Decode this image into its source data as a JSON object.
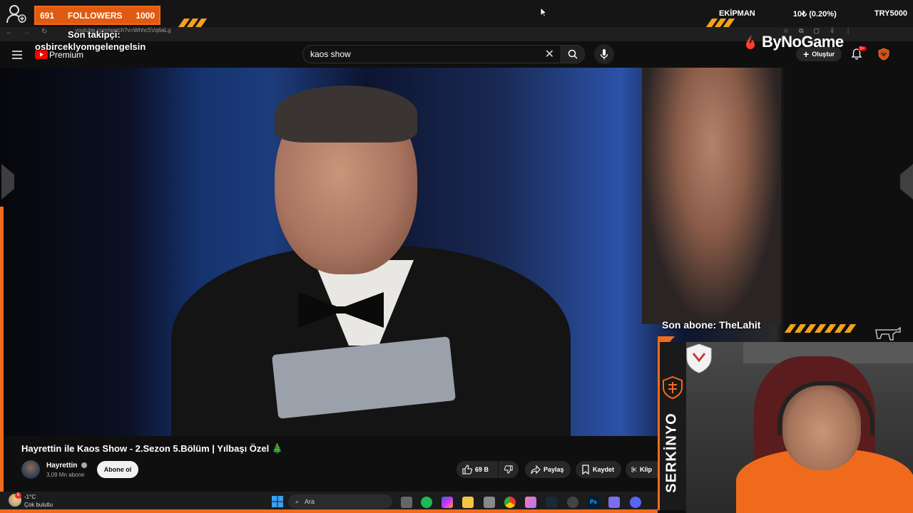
{
  "overlay": {
    "followers_current": "691",
    "followers_label": "FOLLOWERS",
    "followers_goal": "1000",
    "last_follower_label": "Son takipçi:",
    "last_follower_name": "osbirceklyomgelengelsin",
    "ticker_item1": "EKİPMAN",
    "ticker_item2": "10₺ (0.20%)",
    "ticker_item3": "TRY5000",
    "brand": "ByNoGame",
    "last_sub_label": "Son abone: TheLahit",
    "streamer_name": "SERKİNYO"
  },
  "browser": {
    "url": "youtube.com/watch?v=Whhc5Vq6aLg"
  },
  "youtube": {
    "logo_text": "Premium",
    "search_value": "kaos show",
    "create_label": "Oluştur",
    "notif_count": "9+"
  },
  "video": {
    "title": "Hayrettin ile Kaos Show - 2.Sezon 5.Bölüm | Yılbaşı Özel 🎄",
    "channel": "Hayrettin",
    "subscribers": "3,09 Mn abone",
    "subscribe_label": "Abone ol",
    "likes": "69 B",
    "share_label": "Paylaş",
    "save_label": "Kaydet",
    "clip_label": "Klip"
  },
  "taskbar": {
    "weather_temp": "-1°C",
    "weather_desc": "Çok bulutlu",
    "search_label": "Ara"
  },
  "colors": {
    "accent": "#f26b1d",
    "stripe": "#f2a31b"
  }
}
